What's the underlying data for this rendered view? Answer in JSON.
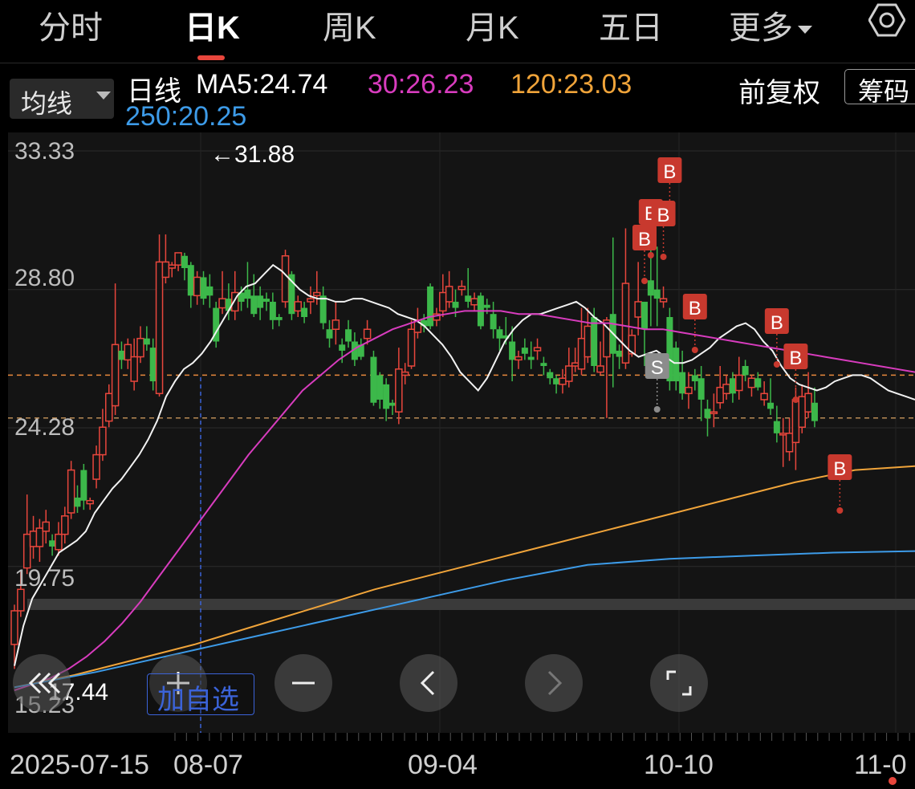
{
  "tabs": [
    {
      "label": "分时"
    },
    {
      "label": "日K",
      "active": true
    },
    {
      "label": "周K"
    },
    {
      "label": "月K"
    },
    {
      "label": "五日"
    },
    {
      "label": "更多"
    }
  ],
  "settings_icon": "gear-hex-icon",
  "ma_selector": {
    "label": "均线",
    "icon": "caret-down-icon"
  },
  "legend": {
    "line_type": "日线",
    "ma5": "MA5:24.74",
    "ma30": "30:26.23",
    "ma120": "120:23.03",
    "ma250": "250:20.25"
  },
  "adjust_label": "前复权",
  "chip_label": "筹码",
  "colors": {
    "up": "#e8463c",
    "down": "#3cb84a",
    "ma5": "#f2f2f2",
    "ma30": "#d83cbe",
    "ma120": "#f0a43a",
    "ma250": "#3d9be8",
    "buy_marker": "#c8392e",
    "sell_marker": "#8c8c8c",
    "add_fav": "#3b63d8"
  },
  "controls": [
    {
      "name": "collapse-left-button",
      "icon": "double-chevron-left-icon"
    },
    {
      "name": "zoom-in-button",
      "icon": "plus-icon"
    },
    {
      "name": "zoom-out-button",
      "icon": "minus-icon"
    },
    {
      "name": "prev-button",
      "icon": "chevron-left-icon"
    },
    {
      "name": "next-button",
      "icon": "chevron-right-icon"
    },
    {
      "name": "fullscreen-button",
      "icon": "fullscreen-icon"
    }
  ],
  "add_favorite_label": "加自选",
  "chart_data": {
    "type": "candlestick",
    "y_ticks": [
      "33.33",
      "28.80",
      "24.28",
      "19.75",
      "15.23"
    ],
    "ylim": [
      15.23,
      33.33
    ],
    "high_annotation": "←31.88",
    "low_annotation": "17.44",
    "x_labels": [
      "2025-07-15",
      "08-07",
      "09-04",
      "10-10",
      "11-0"
    ],
    "reference_lines": [
      26.0,
      24.6
    ],
    "candles": [
      [
        17.2,
        18.3,
        16.4,
        18.5
      ],
      [
        18.3,
        19.0,
        18.1,
        19.6
      ],
      [
        19.7,
        20.8,
        19.5,
        22.1
      ],
      [
        20.4,
        20.9,
        20.0,
        21.4
      ],
      [
        20.4,
        21.0,
        19.9,
        21.3
      ],
      [
        20.9,
        21.2,
        20.5,
        21.6
      ],
      [
        20.6,
        20.4,
        20.1,
        20.8
      ],
      [
        20.3,
        20.8,
        20.1,
        21.2
      ],
      [
        20.8,
        21.4,
        20.5,
        21.7
      ],
      [
        21.5,
        22.9,
        21.3,
        23.2
      ],
      [
        22.0,
        21.7,
        21.5,
        22.4
      ],
      [
        22.9,
        21.9,
        21.6,
        23.1
      ],
      [
        21.8,
        21.9,
        21.6,
        22.0
      ],
      [
        22.6,
        23.4,
        22.3,
        23.7
      ],
      [
        23.4,
        24.3,
        23.2,
        24.9
      ],
      [
        24.5,
        25.4,
        24.3,
        25.7
      ],
      [
        25.0,
        27.0,
        24.7,
        29.0
      ],
      [
        26.8,
        26.5,
        26.2,
        27.1
      ],
      [
        26.5,
        27.0,
        26.2,
        27.2
      ],
      [
        25.8,
        26.6,
        25.5,
        27.2
      ],
      [
        26.6,
        27.2,
        26.4,
        27.6
      ],
      [
        27.2,
        27.0,
        26.8,
        27.6
      ],
      [
        26.9,
        25.8,
        25.5,
        27.2
      ],
      [
        25.4,
        29.7,
        25.3,
        30.6
      ],
      [
        29.2,
        29.7,
        29.0,
        30.6
      ],
      [
        29.5,
        29.6,
        29.2,
        29.7
      ],
      [
        29.6,
        30.0,
        29.4,
        30.0
      ],
      [
        29.9,
        29.5,
        29.1,
        30.0
      ],
      [
        29.6,
        28.6,
        28.2,
        29.7
      ],
      [
        28.6,
        29.2,
        28.3,
        29.4
      ],
      [
        29.2,
        28.5,
        28.3,
        29.4
      ],
      [
        28.9,
        28.6,
        28.2,
        29.3
      ],
      [
        28.2,
        27.1,
        26.9,
        28.4
      ],
      [
        28.2,
        28.5,
        28.0,
        29.4
      ],
      [
        28.5,
        28.1,
        27.8,
        29.0
      ],
      [
        28.1,
        28.7,
        27.8,
        29.4
      ],
      [
        28.7,
        28.4,
        28.1,
        28.9
      ],
      [
        28.8,
        28.5,
        28.2,
        29.7
      ],
      [
        28.6,
        28.0,
        27.9,
        29.3
      ],
      [
        28.6,
        28.2,
        27.8,
        28.9
      ],
      [
        28.5,
        28.4,
        28.1,
        28.7
      ],
      [
        28.4,
        27.8,
        27.5,
        28.7
      ],
      [
        27.9,
        27.8,
        27.6,
        28.0
      ],
      [
        28.4,
        29.9,
        28.2,
        30.1
      ],
      [
        29.3,
        28.0,
        27.8,
        29.4
      ],
      [
        28.1,
        28.4,
        27.9,
        28.6
      ],
      [
        28.2,
        27.9,
        27.7,
        28.4
      ],
      [
        28.4,
        28.5,
        28.0,
        28.9
      ],
      [
        28.6,
        28.7,
        28.3,
        29.4
      ],
      [
        28.6,
        27.7,
        27.5,
        28.9
      ],
      [
        27.5,
        27.2,
        26.9,
        27.8
      ],
      [
        27.5,
        27.8,
        27.0,
        28.4
      ],
      [
        27.0,
        26.8,
        26.4,
        27.2
      ],
      [
        27.5,
        27.1,
        26.9,
        27.8
      ],
      [
        27.1,
        26.5,
        26.3,
        27.4
      ],
      [
        27.0,
        26.6,
        26.5,
        27.2
      ],
      [
        27.2,
        27.5,
        27.0,
        27.8
      ],
      [
        26.6,
        25.1,
        25.0,
        26.8
      ],
      [
        26.0,
        25.2,
        24.9,
        26.1
      ],
      [
        25.7,
        24.9,
        24.5,
        25.9
      ],
      [
        25.1,
        25.0,
        24.7,
        25.2
      ],
      [
        24.8,
        26.2,
        24.4,
        26.9
      ],
      [
        26.0,
        26.1,
        25.7,
        26.4
      ],
      [
        26.3,
        27.5,
        26.2,
        27.8
      ],
      [
        27.4,
        27.8,
        27.2,
        28.2
      ],
      [
        27.8,
        27.6,
        27.4,
        28.0
      ],
      [
        28.9,
        27.6,
        27.5,
        29.0
      ],
      [
        27.8,
        28.0,
        27.6,
        28.2
      ],
      [
        28.1,
        28.7,
        27.9,
        29.3
      ],
      [
        28.4,
        28.9,
        28.2,
        29.4
      ],
      [
        28.4,
        28.2,
        27.9,
        28.8
      ],
      [
        28.8,
        28.9,
        28.6,
        29.1
      ],
      [
        28.6,
        28.4,
        28.2,
        29.5
      ],
      [
        28.3,
        28.5,
        28.1,
        28.7
      ],
      [
        28.6,
        27.6,
        27.5,
        28.7
      ],
      [
        28.3,
        28.2,
        28.0,
        28.5
      ],
      [
        28.0,
        27.5,
        27.2,
        28.4
      ],
      [
        27.5,
        27.2,
        26.8,
        27.6
      ],
      [
        27.3,
        27.2,
        27.0,
        27.9
      ],
      [
        27.1,
        26.5,
        25.8,
        27.6
      ],
      [
        26.5,
        26.6,
        26.2,
        26.8
      ],
      [
        26.9,
        26.7,
        26.5,
        27.2
      ],
      [
        26.6,
        26.5,
        26.2,
        27.1
      ],
      [
        26.8,
        26.9,
        26.5,
        27.2
      ],
      [
        26.4,
        26.3,
        26.0,
        26.6
      ],
      [
        26.1,
        25.9,
        25.7,
        26.2
      ],
      [
        25.9,
        25.7,
        25.4,
        26.0
      ],
      [
        25.7,
        25.9,
        25.4,
        26.2
      ],
      [
        25.8,
        26.3,
        25.6,
        26.9
      ],
      [
        26.3,
        26.4,
        26.1,
        26.9
      ],
      [
        26.2,
        27.2,
        26.0,
        28.2
      ],
      [
        26.6,
        27.6,
        26.4,
        28.2
      ],
      [
        27.9,
        26.3,
        26.1,
        28.2
      ],
      [
        26.1,
        26.3,
        26.0,
        27.1
      ],
      [
        26.6,
        27.8,
        24.6,
        27.9
      ],
      [
        28.0,
        26.7,
        25.6,
        30.5
      ],
      [
        26.8,
        26.6,
        26.2,
        27.0
      ],
      [
        26.4,
        29.0,
        26.2,
        30.8
      ],
      [
        26.7,
        27.3,
        26.6,
        27.5
      ],
      [
        27.9,
        28.4,
        27.3,
        29.7
      ],
      [
        28.4,
        27.5,
        26.3,
        28.4
      ],
      [
        29.1,
        28.6,
        27.6,
        30.6
      ],
      [
        28.8,
        28.5,
        27.6,
        30.2
      ],
      [
        28.4,
        28.5,
        28.2,
        28.9
      ],
      [
        27.9,
        25.8,
        25.5,
        28.2
      ],
      [
        26.9,
        25.8,
        25.5,
        27.1
      ],
      [
        26.1,
        25.4,
        25.2,
        26.8
      ],
      [
        25.4,
        25.6,
        24.9,
        26.1
      ],
      [
        26.0,
        25.8,
        25.5,
        26.2
      ],
      [
        25.9,
        25.2,
        24.5,
        26.3
      ],
      [
        24.9,
        24.6,
        24.0,
        25.2
      ],
      [
        24.8,
        24.8,
        24.3,
        25.4
      ],
      [
        25.1,
        25.6,
        24.9,
        26.3
      ],
      [
        25.4,
        25.7,
        25.2,
        26.0
      ],
      [
        25.9,
        25.4,
        25.1,
        26.1
      ],
      [
        25.5,
        26.0,
        25.2,
        26.6
      ],
      [
        26.3,
        26.0,
        25.8,
        26.5
      ],
      [
        25.6,
        25.9,
        25.3,
        26.0
      ],
      [
        25.9,
        25.6,
        25.5,
        26.1
      ],
      [
        25.2,
        25.4,
        25.0,
        25.8
      ],
      [
        25.1,
        24.9,
        24.7,
        25.9
      ],
      [
        24.5,
        24.1,
        23.8,
        25.0
      ],
      [
        24.1,
        24.1,
        23.0,
        24.6
      ],
      [
        23.5,
        24.1,
        23.2,
        24.6
      ],
      [
        23.8,
        25.2,
        22.9,
        25.6
      ],
      [
        24.3,
        25.3,
        24.1,
        25.7
      ],
      [
        24.8,
        25.4,
        24.6,
        26.1
      ],
      [
        25.1,
        24.5,
        24.3,
        25.6
      ]
    ],
    "series": [
      {
        "name": "MA5",
        "values": [
          16.5,
          17.8,
          18.7,
          19.2,
          19.7,
          20.2,
          20.4,
          20.6,
          20.9,
          21.5,
          21.9,
          22.3,
          22.6,
          23.0,
          23.4,
          23.9,
          24.5,
          25.3,
          25.8,
          26.2,
          26.4,
          26.7,
          27.1,
          27.6,
          28.1,
          28.6,
          28.9,
          29.0,
          29.3,
          29.6,
          29.4,
          29.1,
          28.8,
          28.6,
          28.5,
          28.5,
          28.4,
          28.4,
          28.5,
          28.5,
          28.4,
          28.3,
          28.2,
          28.0,
          27.9,
          27.8,
          27.6,
          27.3,
          27.0,
          26.6,
          26.1,
          25.8,
          25.5,
          25.9,
          26.5,
          27.1,
          27.5,
          27.8,
          28.0,
          28.0,
          28.1,
          28.2,
          28.3,
          28.4,
          28.2,
          27.9,
          27.7,
          27.4,
          27.1,
          26.8,
          26.6,
          26.7,
          26.8,
          26.6,
          26.4,
          26.4,
          26.5,
          26.7,
          26.9,
          27.2,
          27.4,
          27.6,
          27.7,
          27.5,
          27.1,
          26.8,
          26.3,
          25.9,
          25.7,
          25.6,
          25.5,
          25.6,
          25.8,
          25.9,
          26.0,
          26.0,
          25.9,
          25.7,
          25.5,
          25.4,
          25.3,
          25.2
        ]
      },
      {
        "name": "30",
        "values": [
          15.7,
          15.9,
          16.1,
          16.4,
          16.8,
          17.3,
          17.9,
          18.6,
          19.4,
          20.2,
          21.0,
          21.8,
          22.6,
          23.4,
          24.1,
          24.8,
          25.5,
          26.0,
          26.5,
          26.9,
          27.2,
          27.5,
          27.7,
          27.9,
          28.0,
          28.1,
          28.1,
          28.1,
          28.0,
          28.0,
          27.9,
          27.8,
          27.7,
          27.7,
          27.6,
          27.5,
          27.5,
          27.4,
          27.3,
          27.2,
          27.1,
          27.0,
          26.9,
          26.8,
          26.7,
          26.6,
          26.5,
          26.4,
          26.3,
          26.2,
          26.1
        ]
      },
      {
        "name": "120",
        "values": [
          15.8,
          16.2,
          16.7,
          17.2,
          17.8,
          18.4,
          19.0,
          19.5,
          20.0,
          20.5,
          21.0,
          21.5,
          22.0,
          22.5,
          22.9,
          23.03
        ]
      },
      {
        "name": "250",
        "values": [
          15.8,
          16.3,
          16.9,
          17.5,
          18.1,
          18.7,
          19.3,
          19.8,
          20.0,
          20.1,
          20.2,
          20.25
        ]
      }
    ],
    "signals": [
      {
        "type": "B",
        "index": 100
      },
      {
        "type": "B",
        "index": 101
      },
      {
        "type": "B",
        "index": 104
      },
      {
        "type": "B",
        "index": 103
      },
      {
        "type": "S",
        "index": 102
      },
      {
        "type": "B",
        "index": 108
      },
      {
        "type": "B",
        "index": 121
      },
      {
        "type": "B",
        "index": 124
      },
      {
        "type": "B",
        "index": 131
      }
    ]
  }
}
